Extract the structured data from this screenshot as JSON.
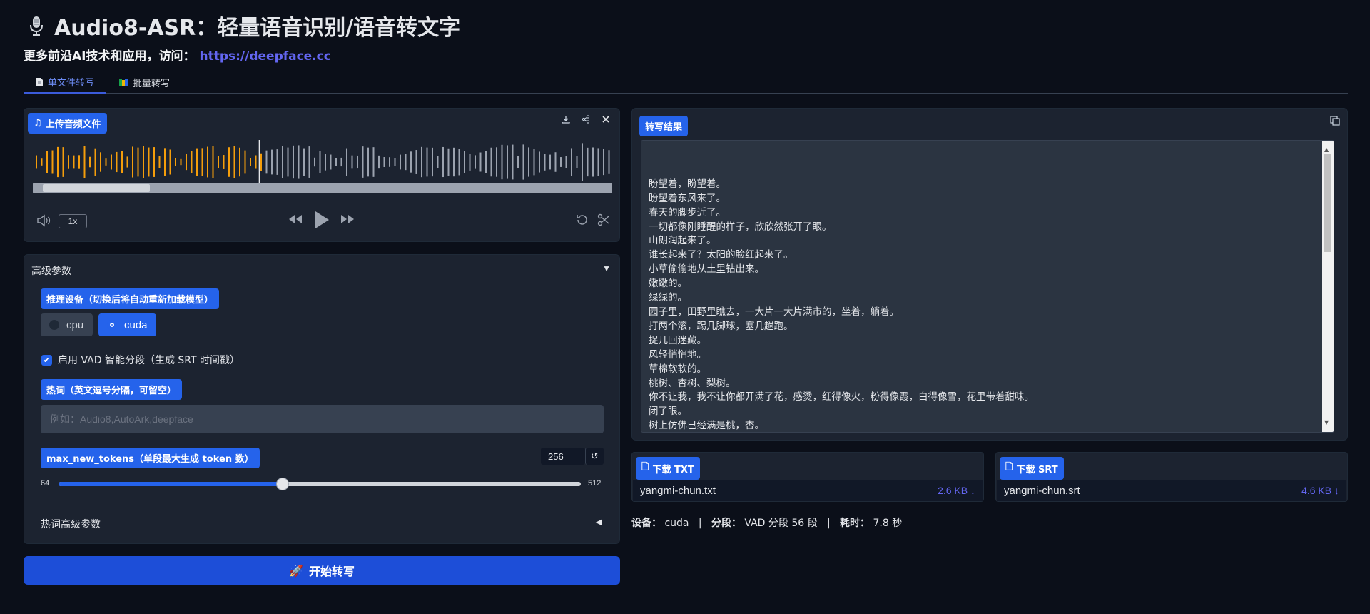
{
  "header": {
    "title": "Audio8-ASR：轻量语音识别/语音转文字",
    "subtitle_prefix": "更多前沿AI技术和应用，访问：",
    "link": "https://deepface.cc"
  },
  "tabs": [
    {
      "label": "单文件转写",
      "icon": "document-icon"
    },
    {
      "label": "批量转写",
      "icon": "books-icon"
    }
  ],
  "audio": {
    "label": "上传音频文件",
    "rate": "1x",
    "progress": 0.39
  },
  "advanced": {
    "header": "高级参数",
    "device_label": "推理设备（切换后将自动重新加载模型）",
    "device_options": [
      "cpu",
      "cuda"
    ],
    "device_selected": "cuda",
    "vad_label": "启用 VAD 智能分段（生成 SRT 时间戳）",
    "vad_checked": true,
    "hotwords_label": "热词（英文逗号分隔，可留空）",
    "hotwords_placeholder": "例如：Audio8,AutoArk,deepface",
    "tokens_label": "max_new_tokens（单段最大生成 token 数）",
    "tokens_value": "256",
    "tokens_min": "64",
    "tokens_max": "512",
    "hotword_adv_label": "热词高级参数"
  },
  "start_button": "开始转写",
  "result": {
    "label": "转写结果",
    "text": "盼望着，盼望着。\n盼望着东风来了。\n春天的脚步近了。\n一切都像刚睡醒的样子，欣欣然张开了眼。\n山朗润起来了。\n谁长起来了？太阳的脸红起来了。\n小草偷偷地从土里钻出来。\n嫩嫩的。\n绿绿的。\n园子里，田野里瞧去，一大片一大片满市的，坐着，躺着。\n打两个滚，踢几脚球，塞几趟跑。\n捉几回迷藏。\n风轻悄悄地。\n草棉软软的。\n桃树、杏树、梨树。\n你不让我，我不让你都开满了花，感烫，红得像火，粉得像霞，白得像雪，花里带着甜味。\n闭了眼。\n树上仿佛已经满是桃，杏。\n离。\n画下成千成百的蜜蜂，懵懵的闹着。\n大小的蝴蝶飞来飞去"
  },
  "downloads": [
    {
      "label": "下载 TXT",
      "file": "yangmi-chun.txt",
      "size": "2.6 KB ↓"
    },
    {
      "label": "下载 SRT",
      "file": "yangmi-chun.srt",
      "size": "4.6 KB ↓"
    }
  ],
  "status": {
    "device_key": "设备：",
    "device_val": "cuda",
    "seg_key": "分段：",
    "seg_val": "VAD 分段 56 段",
    "time_key": "耗时：",
    "time_val": "7.8 秒",
    "sep": "|"
  },
  "colors": {
    "accent": "#2563eb",
    "played_wave": "#f59e0b",
    "unplayed_wave": "#9ca3af",
    "background": "#0b0f19"
  }
}
